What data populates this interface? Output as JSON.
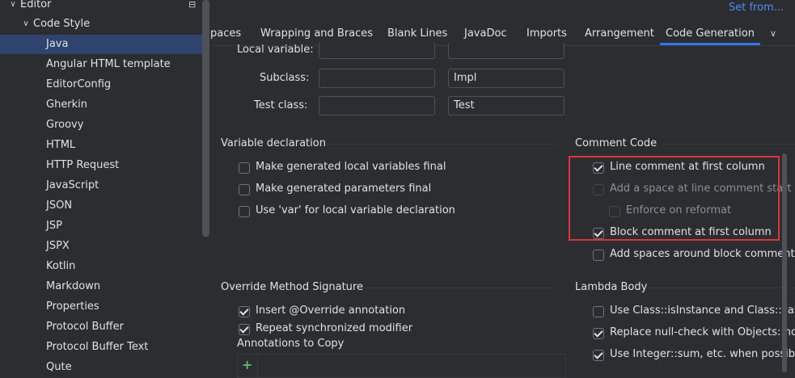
{
  "sidebar": {
    "editor_label": "Editor",
    "code_style_label": "Code Style",
    "items": [
      "Java",
      "Angular HTML template",
      "EditorConfig",
      "Gherkin",
      "Groovy",
      "HTML",
      "HTTP Request",
      "JavaScript",
      "JSON",
      "JSP",
      "JSPX",
      "Kotlin",
      "Markdown",
      "Properties",
      "Protocol Buffer",
      "Protocol Buffer Text",
      "Qute"
    ],
    "selected": "Java"
  },
  "header": {
    "set_from": "Set from..."
  },
  "tabs": [
    "paces",
    "Wrapping and Braces",
    "Blank Lines",
    "JavaDoc",
    "Imports",
    "Arrangement",
    "Code Generation"
  ],
  "active_tab": "Code Generation",
  "naming": {
    "local_variable_label": "Local variable:",
    "subclass_label": "Subclass:",
    "subclass_suffix": "Impl",
    "test_class_label": "Test class:",
    "test_class_suffix": "Test"
  },
  "variable_declaration": {
    "title": "Variable declaration",
    "options": [
      {
        "label": "Make generated local variables final",
        "checked": false
      },
      {
        "label": "Make generated parameters final",
        "checked": false
      },
      {
        "label": "Use 'var' for local variable declaration",
        "checked": false
      }
    ]
  },
  "comment_code": {
    "title": "Comment Code",
    "options": [
      {
        "label": "Line comment at first column",
        "checked": true,
        "disabled": false
      },
      {
        "label": "Add a space at line comment start",
        "checked": false,
        "disabled": true
      },
      {
        "label": "Enforce on reformat",
        "checked": false,
        "disabled": true
      },
      {
        "label": "Block comment at first column",
        "checked": true,
        "disabled": false
      },
      {
        "label": "Add spaces around block comments",
        "checked": false,
        "disabled": false
      }
    ]
  },
  "override_method": {
    "title": "Override Method Signature",
    "options": [
      {
        "label": "Insert @Override annotation",
        "checked": true
      },
      {
        "label": "Repeat synchronized modifier",
        "checked": true
      }
    ],
    "annotations_label": "Annotations to Copy",
    "add_symbol": "+"
  },
  "lambda_body": {
    "title": "Lambda Body",
    "options": [
      {
        "label": "Use Class::isInstance and Class::cas",
        "checked": false
      },
      {
        "label": "Replace null-check with Objects::no",
        "checked": true
      },
      {
        "label": "Use Integer::sum, etc. when possib",
        "checked": true
      }
    ]
  }
}
